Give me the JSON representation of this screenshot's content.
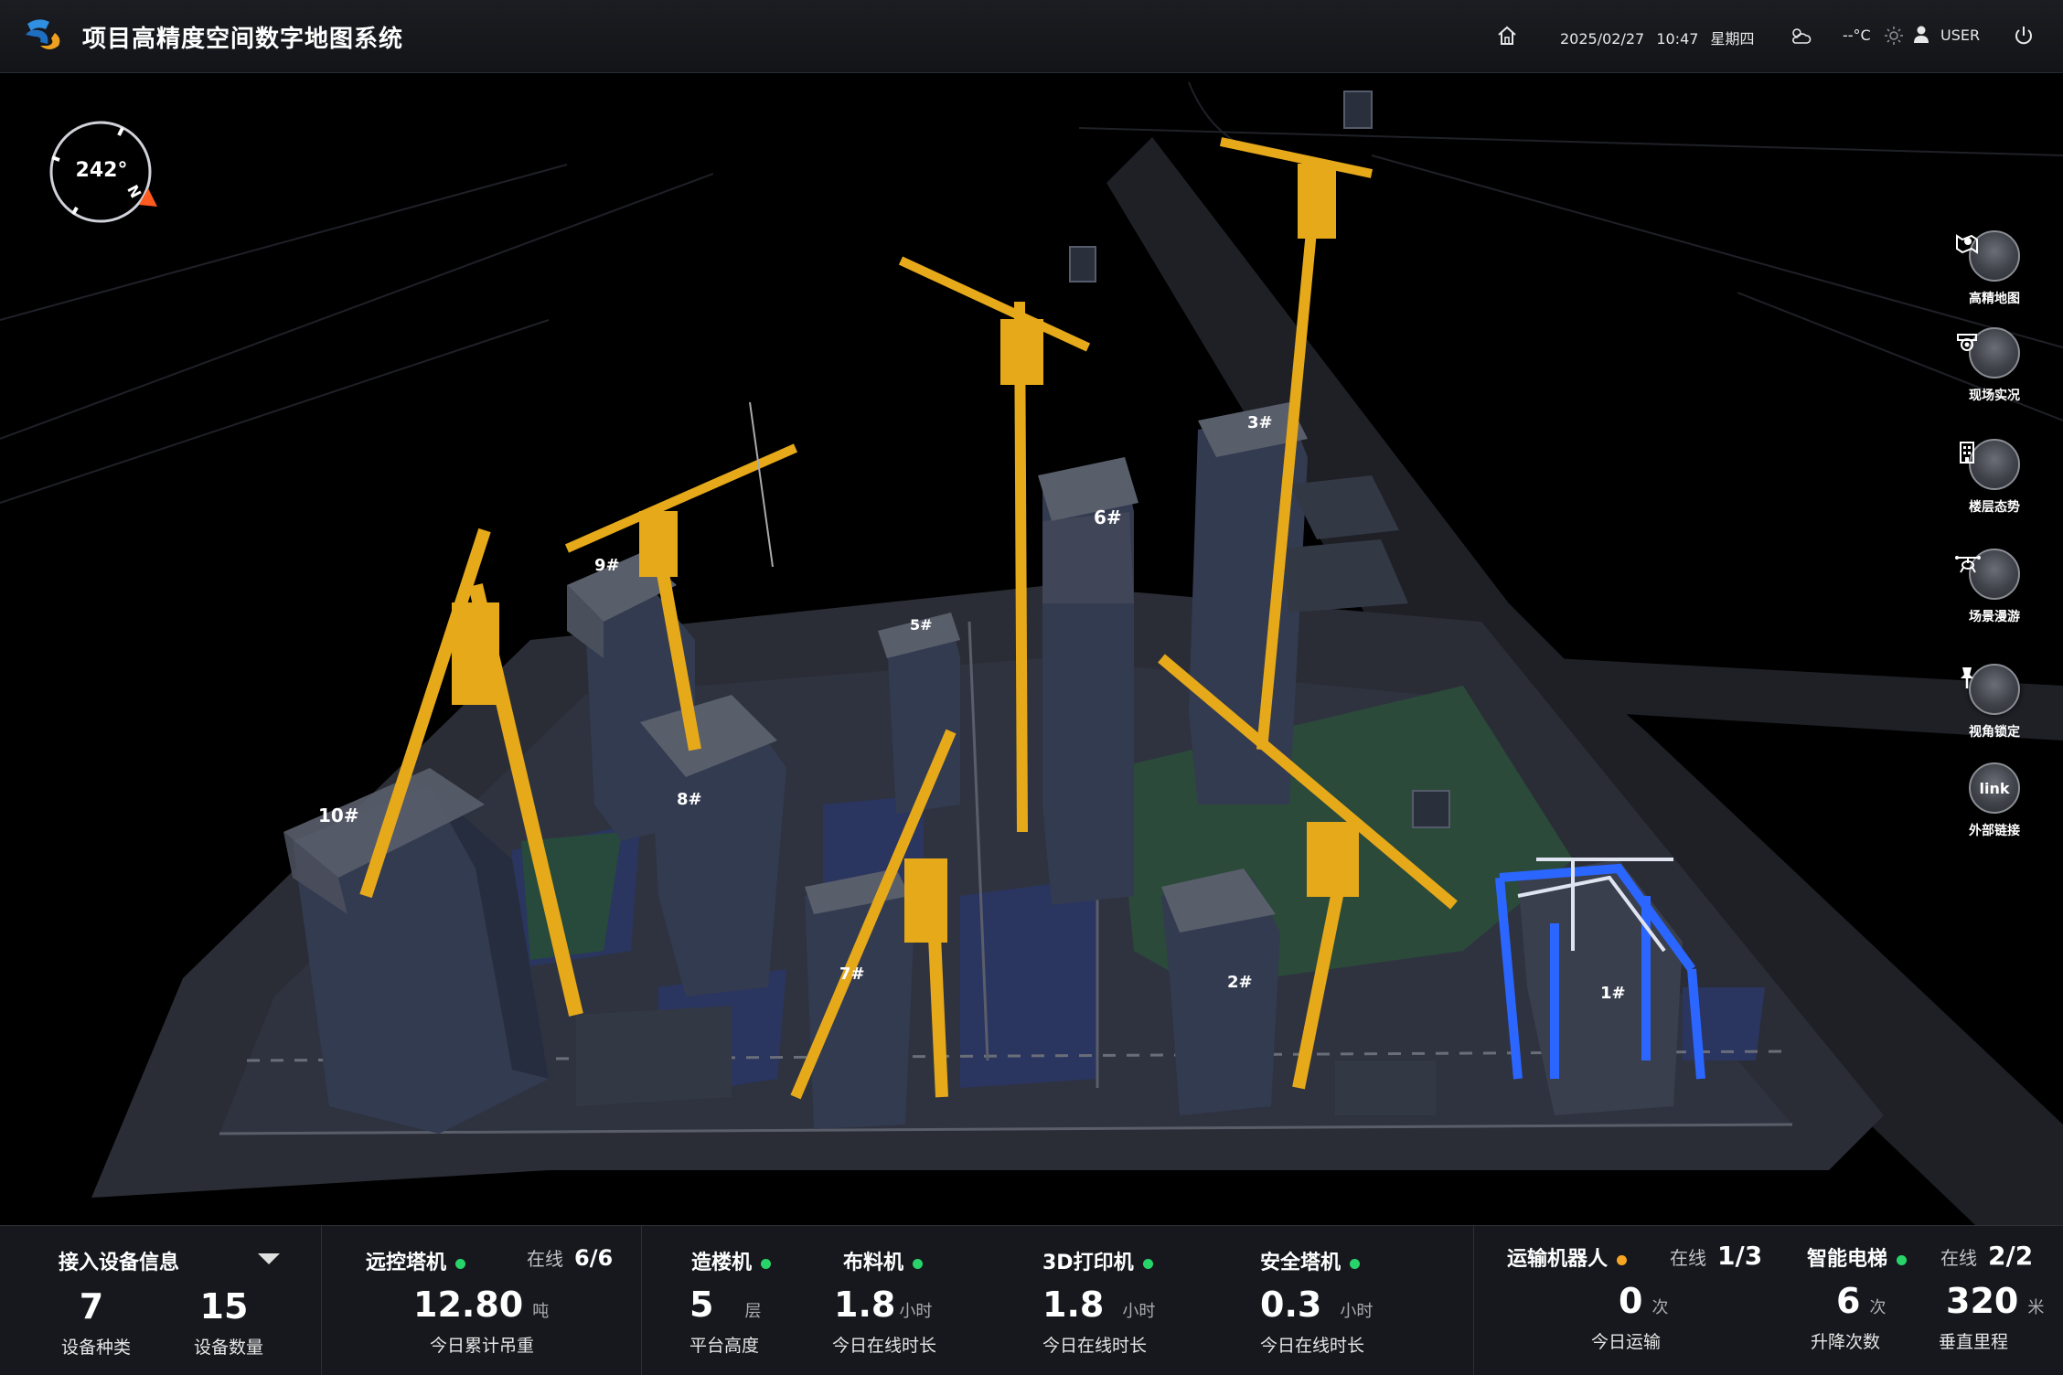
{
  "header": {
    "title": "项目高精度空间数字地图系统",
    "date": "2025/02/27",
    "time": "10:47",
    "weekday": "星期四",
    "temperature": "--°C",
    "user": "USER",
    "icons": [
      "logo-icon",
      "home-icon",
      "weather-icon",
      "sun-icon",
      "user-icon",
      "power-icon"
    ]
  },
  "compass": {
    "heading": "242°",
    "direction": "N"
  },
  "map": {
    "buildings": [
      "1#",
      "2#",
      "3#",
      "5#",
      "6#",
      "7#",
      "8#",
      "9#",
      "10#"
    ],
    "colors": {
      "crane": "#e6a91a",
      "building": "#333b50",
      "ground": "#2b3a6a",
      "road": "#2c2f36",
      "green": "#2b4a3a",
      "printer": "#2255dd"
    }
  },
  "toolbar": [
    {
      "label": "高精地图",
      "icon": "map-icon"
    },
    {
      "label": "现场实况",
      "icon": "camera-icon"
    },
    {
      "label": "楼层态势",
      "icon": "building-icon"
    },
    {
      "label": "场景漫游",
      "icon": "drone-icon"
    },
    {
      "label": "视角锁定",
      "icon": "pin-icon"
    },
    {
      "label": "外部链接",
      "icon": "link-icon",
      "text": "link"
    }
  ],
  "bottom": {
    "devices": {
      "title": "接入设备信息",
      "types_value": "7",
      "types_label": "设备种类",
      "count_value": "15",
      "count_label": "设备数量"
    },
    "crane": {
      "title": "远控塔机",
      "online_label": "在线",
      "online_value": "6/6",
      "value": "12.80",
      "unit": "吨",
      "label": "今日累计吊重"
    },
    "builder": {
      "title": "造楼机",
      "value": "5",
      "unit": "层",
      "label": "平台高度"
    },
    "distributor": {
      "title": "布料机",
      "value": "1.8",
      "unit": "小时",
      "label": "今日在线时长"
    },
    "printer": {
      "title": "3D打印机",
      "value": "1.8",
      "unit": "小时",
      "label": "今日在线时长"
    },
    "safety_crane": {
      "title": "安全塔机",
      "value": "0.3",
      "unit": "小时",
      "label": "今日在线时长"
    },
    "robot": {
      "title": "运输机器人",
      "online_label": "在线",
      "online_value": "1/3",
      "value": "0",
      "unit": "次",
      "label": "今日运输"
    },
    "elevator": {
      "title": "智能电梯",
      "online_label": "在线",
      "online_value": "2/2",
      "lift_value": "6",
      "lift_unit": "次",
      "lift_label": "升降次数",
      "dist_value": "320",
      "dist_unit": "米",
      "dist_label": "垂直里程"
    }
  }
}
